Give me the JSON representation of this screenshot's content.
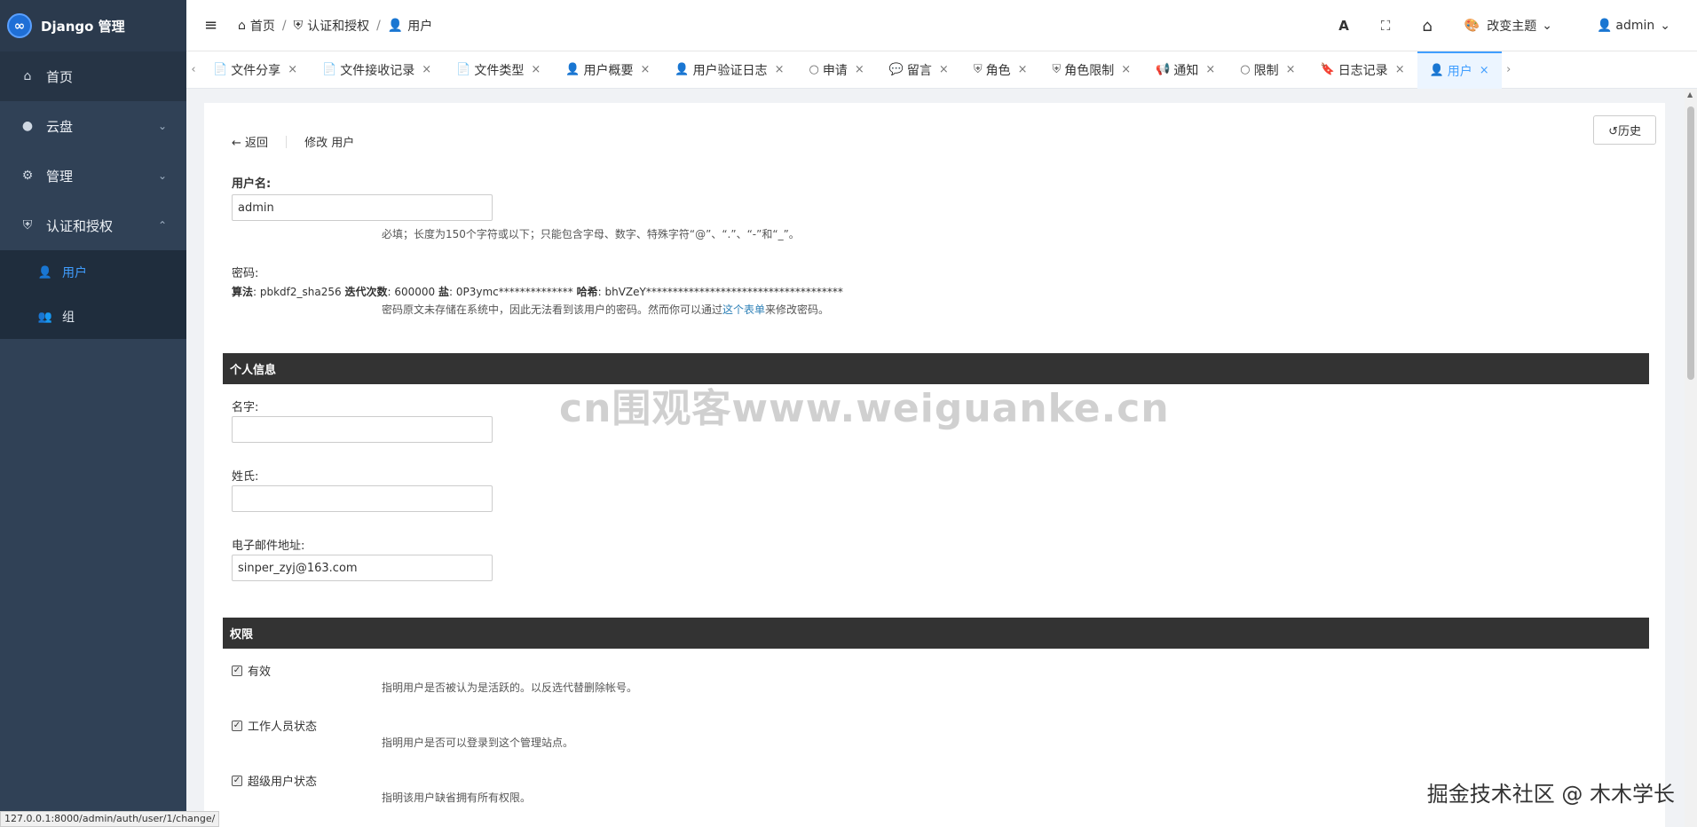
{
  "app": {
    "logo_symbol": "∞",
    "title": "Django 管理"
  },
  "sidebar": {
    "items": [
      {
        "label": "首页",
        "icon": "home-icon",
        "glyph": "⌂"
      },
      {
        "label": "云盘",
        "icon": "circle-icon",
        "glyph": "●",
        "chevron": "⌄"
      },
      {
        "label": "管理",
        "icon": "gear-icon",
        "glyph": "⚙",
        "chevron": "⌄"
      },
      {
        "label": "认证和授权",
        "icon": "shield-icon",
        "glyph": "⛨",
        "chevron": "⌃"
      }
    ],
    "subitems": [
      {
        "label": "用户",
        "icon": "user-icon",
        "glyph": "👤",
        "active": true
      },
      {
        "label": "组",
        "icon": "users-icon",
        "glyph": "👥",
        "active": false
      }
    ]
  },
  "header": {
    "menu_glyph": "≡",
    "breadcrumb": [
      {
        "label": "首页",
        "glyph": "⌂"
      },
      {
        "label": "认证和授权",
        "glyph": "⛨"
      },
      {
        "label": "用户",
        "glyph": "👤"
      }
    ],
    "separator": "/",
    "font_glyph": "A",
    "fullscreen_glyph": "⛶",
    "home_glyph": "⌂",
    "theme_label": "改变主题",
    "theme_glyph": "🎨",
    "dropdown_glyph": "⌄",
    "user_label": "admin",
    "user_glyph": "👤"
  },
  "tabs": {
    "left_arrow": "‹",
    "right_arrow": "›",
    "close_glyph": "×",
    "items": [
      {
        "label": "文件分享",
        "glyph": "📄"
      },
      {
        "label": "文件接收记录",
        "glyph": "📄"
      },
      {
        "label": "文件类型",
        "glyph": "📄"
      },
      {
        "label": "用户概要",
        "glyph": "👤"
      },
      {
        "label": "用户验证日志",
        "glyph": "👤"
      },
      {
        "label": "申请",
        "glyph": "○"
      },
      {
        "label": "留言",
        "glyph": "💬"
      },
      {
        "label": "角色",
        "glyph": "⛨"
      },
      {
        "label": "角色限制",
        "glyph": "⛨"
      },
      {
        "label": "通知",
        "glyph": "📢"
      },
      {
        "label": "限制",
        "glyph": "○"
      },
      {
        "label": "日志记录",
        "glyph": "🔖"
      },
      {
        "label": "用户",
        "glyph": "👤",
        "active": true
      }
    ]
  },
  "form": {
    "history_label": "历史",
    "history_glyph": "↺",
    "back_label": "返回",
    "back_glyph": "←",
    "page_title": "修改 用户",
    "username": {
      "label": "用户名:",
      "value": "admin",
      "help": "必填；长度为150个字符或以下；只能包含字母、数字、特殊字符“@”、“.”、“-”和“_”。"
    },
    "password": {
      "label": "密码:",
      "algo_label": "算法",
      "algo_value": "pbkdf2_sha256",
      "iter_label": "迭代次数",
      "iter_value": "600000",
      "salt_label": "盐",
      "salt_value": "0P3ymc**************",
      "hash_label": "哈希",
      "hash_value": "bhVZeY*************************************",
      "help_before": "密码原文未存储在系统中，因此无法看到该用户的密码。然而你可以通过",
      "help_link": "这个表单",
      "help_after": "来修改密码。"
    },
    "personal_section": "个人信息",
    "first_name": {
      "label": "名字:",
      "value": ""
    },
    "last_name": {
      "label": "姓氏:",
      "value": ""
    },
    "email": {
      "label": "电子邮件地址:",
      "value": "sinper_zyj@163.com"
    },
    "perm_section": "权限",
    "checkbox_glyph": "✓",
    "active": {
      "label": "有效",
      "checked": true,
      "help": "指明用户是否被认为是活跃的。以反选代替删除帐号。"
    },
    "staff": {
      "label": "工作人员状态",
      "checked": true,
      "help": "指明用户是否可以登录到这个管理站点。"
    },
    "superuser": {
      "label": "超级用户状态",
      "checked": true,
      "help": "指明该用户缺省拥有所有权限。"
    }
  },
  "statusbar": {
    "url": "127.0.0.1:8000/admin/auth/user/1/change/"
  },
  "watermarks": {
    "center": "cn围观客www.weiguanke.cn",
    "corner": "掘金技术社区 @ 木木学长"
  }
}
